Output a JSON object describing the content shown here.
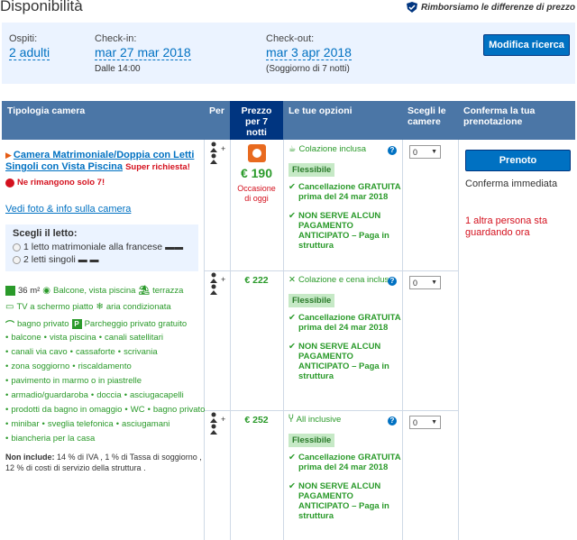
{
  "page": {
    "title": "Disponibilità",
    "refund_text": "Rimborsiamo le differenze di prezzo"
  },
  "search": {
    "guests_label": "Ospiti:",
    "guests_value": "2 adulti",
    "checkin_label": "Check-in:",
    "checkin_value": "mar 27 mar 2018",
    "checkin_time": "Dalle 14:00",
    "checkout_label": "Check-out:",
    "checkout_value": "mar 3 apr 2018",
    "stay_length": "(Soggiorno di 7 notti)",
    "modify_button": "Modifica ricerca"
  },
  "table_header": {
    "room_type": "Tipologia camera",
    "per": "Per",
    "price_line1": "Prezzo",
    "price_line2": "per 7",
    "price_line3": "notti",
    "options": "Le tue opzioni",
    "choose_line1": "Scegli le",
    "choose_line2": "camere",
    "confirm_line1": "Conferma la tua",
    "confirm_line2": "prenotazione"
  },
  "room": {
    "name": "Camera Matrimoniale/Doppia con Letti Singoli con Vista Piscina",
    "request_tag": "Super richiesta!",
    "remaining": "Ne rimangono solo 7!",
    "photos_link": "Vedi foto & info sulla camera",
    "bed_title": "Scegli il letto:",
    "bed_options": [
      "1 letto matrimoniale alla francese",
      "2 letti singoli"
    ],
    "size": "36 m²",
    "features_main": [
      "Balcone, vista piscina",
      "terrazza",
      "TV a schermo piatto",
      "aria condizionata",
      "bagno privato",
      "Parcheggio privato gratuito"
    ],
    "amenities": [
      "balcone",
      "vista piscina",
      "canali satellitari",
      "canali via cavo",
      "cassaforte",
      "scrivania",
      "zona soggiorno",
      "riscaldamento",
      "pavimento in marmo o in piastrelle",
      "armadio/guardaroba",
      "doccia",
      "asciugacapelli",
      "prodotti da bagno in omaggio",
      "WC",
      "bagno privato",
      "minibar",
      "sveglia telefonica",
      "asciugamani",
      "biancheria per la casa"
    ],
    "not_included_label": "Non include:",
    "not_included_text": "14 % di IVA , 1 % di Tassa di soggiorno , 12 % di costi di servizio della struttura ."
  },
  "offers": [
    {
      "price": "€ 190",
      "deal_line1": "Occasione",
      "deal_line2": "di oggi",
      "meal": "Colazione inclusa",
      "flex": "Flessibile",
      "cancel": "Cancellazione GRATUITA prima del 24 mar 2018",
      "prepay": "NON SERVE ALCUN PAGAMENTO ANTICIPATO – Paga in struttura",
      "qty": "0"
    },
    {
      "price": "€ 222",
      "meal": "Colazione e cena incluse",
      "flex": "Flessibile",
      "cancel": "Cancellazione GRATUITA prima del 24 mar 2018",
      "prepay": "NON SERVE ALCUN PAGAMENTO ANTICIPATO – Paga in struttura",
      "qty": "0"
    },
    {
      "price": "€ 252",
      "meal": "All inclusive",
      "flex": "Flessibile",
      "cancel": "Cancellazione GRATUITA prima del 24 mar 2018",
      "prepay": "NON SERVE ALCUN PAGAMENTO ANTICIPATO – Paga in struttura",
      "qty": "0"
    }
  ],
  "confirm": {
    "book_button": "Prenoto",
    "instant": "Conferma immediata",
    "watching": "1 altra persona sta guardando ora"
  },
  "colors": {
    "brand_blue": "#0071c2",
    "header_blue": "#4b76a6",
    "dark_blue": "#003580",
    "green": "#2a9a2a",
    "red": "#d4111e"
  }
}
